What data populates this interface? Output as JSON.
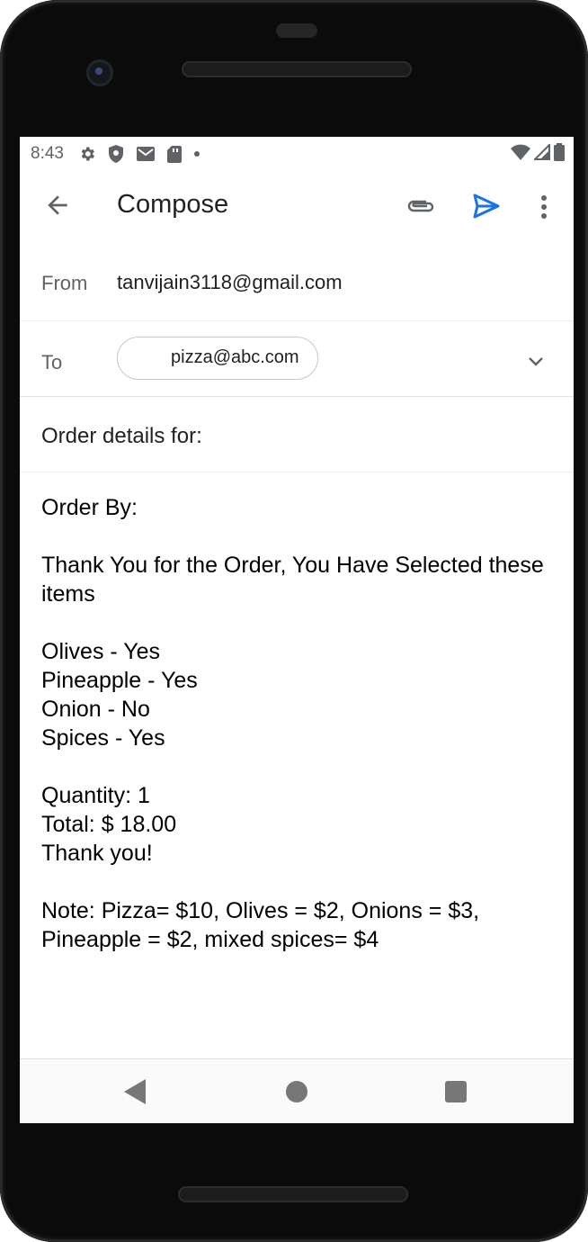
{
  "status_bar": {
    "time": "8:43",
    "icons": [
      "gear-icon",
      "shield-icon",
      "gmail-icon",
      "sd-card-icon",
      "dot-icon"
    ],
    "right_icons": [
      "wifi-icon",
      "signal-icon",
      "battery-icon"
    ]
  },
  "app_bar": {
    "title": "Compose",
    "actions": [
      "attach-icon",
      "send-icon",
      "more-vert-icon"
    ],
    "accent_color": "#1a73e8"
  },
  "compose": {
    "from_label": "From",
    "from_value": "tanvijain3118@gmail.com",
    "to_label": "To",
    "to_chip": "pizza@abc.com",
    "subject": "Order details for:",
    "body": {
      "order_by": "Order By:",
      "thanks_line": "Thank You for the Order, You Have Selected these items",
      "items": [
        "Olives - Yes",
        "Pineapple - Yes",
        "Onion - No",
        "Spices - Yes"
      ],
      "quantity": "Quantity: 1",
      "total": "Total: $ 18.00",
      "thank_you": "Thank you!",
      "note": "Note: Pizza= $10, Olives = $2, Onions = $3, Pineapple = $2, mixed spices= $4"
    }
  },
  "nav_bar": {
    "buttons": [
      "back-icon",
      "home-icon",
      "recents-icon"
    ]
  }
}
